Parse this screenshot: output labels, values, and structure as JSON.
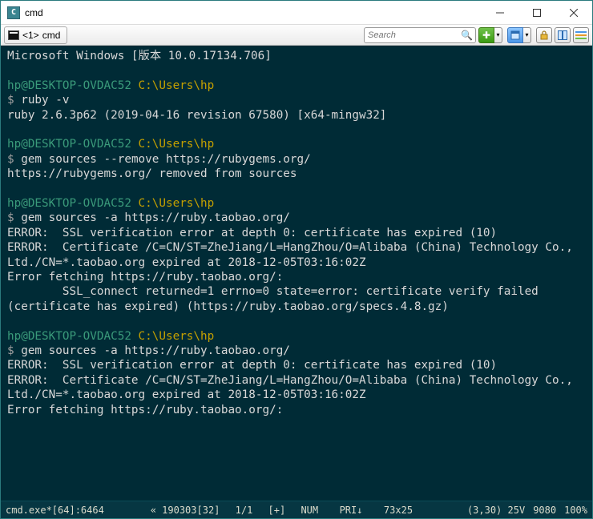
{
  "titlebar": {
    "title": "cmd"
  },
  "tab": {
    "index": "<1>",
    "label": "cmd"
  },
  "search": {
    "placeholder": "Search"
  },
  "terminal": {
    "blocks": [
      {
        "lines": [
          {
            "segs": [
              {
                "cls": "txt",
                "t": "Microsoft Windows [版本 10.0.17134.706]"
              }
            ]
          }
        ]
      },
      {
        "lines": [
          {
            "segs": [
              {
                "cls": "user",
                "t": "hp@DESKTOP-OVDAC52"
              },
              {
                "cls": "txt",
                "t": " "
              },
              {
                "cls": "path",
                "t": "C:\\Users\\hp"
              }
            ]
          },
          {
            "segs": [
              {
                "cls": "sym",
                "t": "$ "
              },
              {
                "cls": "txt",
                "t": "ruby -v"
              }
            ]
          },
          {
            "segs": [
              {
                "cls": "txt",
                "t": "ruby 2.6.3p62 (2019-04-16 revision 67580) [x64-mingw32]"
              }
            ]
          }
        ]
      },
      {
        "lines": [
          {
            "segs": [
              {
                "cls": "user",
                "t": "hp@DESKTOP-OVDAC52"
              },
              {
                "cls": "txt",
                "t": " "
              },
              {
                "cls": "path",
                "t": "C:\\Users\\hp"
              }
            ]
          },
          {
            "segs": [
              {
                "cls": "sym",
                "t": "$ "
              },
              {
                "cls": "txt",
                "t": "gem sources --remove https://rubygems.org/"
              }
            ]
          },
          {
            "segs": [
              {
                "cls": "txt",
                "t": "https://rubygems.org/ removed from sources"
              }
            ]
          }
        ]
      },
      {
        "lines": [
          {
            "segs": [
              {
                "cls": "user",
                "t": "hp@DESKTOP-OVDAC52"
              },
              {
                "cls": "txt",
                "t": " "
              },
              {
                "cls": "path",
                "t": "C:\\Users\\hp"
              }
            ]
          },
          {
            "segs": [
              {
                "cls": "sym",
                "t": "$ "
              },
              {
                "cls": "txt",
                "t": "gem sources -a https://ruby.taobao.org/"
              }
            ]
          },
          {
            "segs": [
              {
                "cls": "txt",
                "t": "ERROR:  SSL verification error at depth 0: certificate has expired (10)"
              }
            ]
          },
          {
            "segs": [
              {
                "cls": "txt",
                "t": "ERROR:  Certificate /C=CN/ST=ZheJiang/L=HangZhou/O=Alibaba (China) Technology Co., Ltd./CN=*.taobao.org expired at 2018-12-05T03:16:02Z"
              }
            ]
          },
          {
            "segs": [
              {
                "cls": "txt",
                "t": "Error fetching https://ruby.taobao.org/:"
              }
            ]
          },
          {
            "segs": [
              {
                "cls": "txt",
                "t": "        SSL_connect returned=1 errno=0 state=error: certificate verify failed (certificate has expired) (https://ruby.taobao.org/specs.4.8.gz)"
              }
            ]
          }
        ]
      },
      {
        "lines": [
          {
            "segs": [
              {
                "cls": "user",
                "t": "hp@DESKTOP-OVDAC52"
              },
              {
                "cls": "txt",
                "t": " "
              },
              {
                "cls": "path",
                "t": "C:\\Users\\hp"
              }
            ]
          },
          {
            "segs": [
              {
                "cls": "sym",
                "t": "$ "
              },
              {
                "cls": "txt",
                "t": "gem sources -a https://ruby.taobao.org/"
              }
            ]
          },
          {
            "segs": [
              {
                "cls": "txt",
                "t": "ERROR:  SSL verification error at depth 0: certificate has expired (10)"
              }
            ]
          },
          {
            "segs": [
              {
                "cls": "txt",
                "t": "ERROR:  Certificate /C=CN/ST=ZheJiang/L=HangZhou/O=Alibaba (China) Technology Co., Ltd./CN=*.taobao.org expired at 2018-12-05T03:16:02Z"
              }
            ]
          },
          {
            "segs": [
              {
                "cls": "txt",
                "t": "Error fetching https://ruby.taobao.org/:"
              }
            ]
          }
        ]
      }
    ]
  },
  "statusbar": {
    "left": "cmd.exe*[64]:6464",
    "mid1": "« 190303[32]",
    "mid2": " 1/1 ",
    "mid3": "[+]",
    "mid4": " NUM ",
    "mid5": " PRI↓ ",
    "mid6": " 73x25",
    "right1": "(3,30) 25V",
    "right2": "9080",
    "right3": "100%"
  }
}
